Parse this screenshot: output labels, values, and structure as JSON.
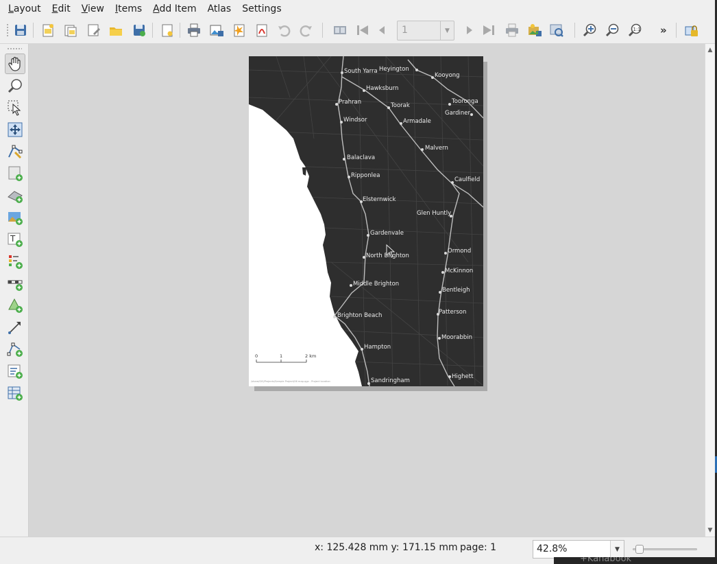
{
  "menubar": {
    "items": [
      {
        "mnemonic": "L",
        "rest": "ayout"
      },
      {
        "mnemonic": "E",
        "rest": "dit"
      },
      {
        "mnemonic": "V",
        "rest": "iew"
      },
      {
        "mnemonic": "I",
        "rest": "tems"
      },
      {
        "mnemonic": "A",
        "rest": "dd Item"
      },
      {
        "mnemonic": "",
        "rest": "Atlas"
      },
      {
        "mnemonic": "",
        "rest": "Settings"
      }
    ]
  },
  "toolbar": {
    "page_number": "1",
    "more_label": "»",
    "icons": [
      "save-icon",
      "new-layout-icon",
      "duplicate-layout-icon",
      "layout-manager-icon",
      "open-template-icon",
      "save-template-icon",
      "page-properties-icon",
      "print-icon",
      "export-image-icon",
      "export-svg-icon",
      "export-pdf-icon",
      "undo-icon",
      "redo-icon",
      "atlas-preview-icon",
      "atlas-first-icon",
      "atlas-previous-icon",
      "atlas-next-icon",
      "atlas-last-icon",
      "atlas-print-icon",
      "atlas-export-image-icon",
      "atlas-settings-icon",
      "zoom-in-icon",
      "zoom-out-icon",
      "zoom-actual-icon",
      "lock-icon"
    ]
  },
  "left_tools": [
    "pan-icon",
    "zoom-tool-icon",
    "select-move-icon",
    "move-content-icon",
    "edit-nodes-icon",
    "add-map-icon",
    "add-3d-map-icon",
    "add-picture-icon",
    "add-label-icon",
    "add-legend-icon",
    "add-scalebar-icon",
    "add-shape-icon",
    "add-arrow-icon",
    "add-nodes-icon",
    "add-html-icon",
    "add-attribute-table-icon"
  ],
  "map": {
    "stations": [
      "South Yarra",
      "Heyington",
      "Kooyong",
      "Hawksburn",
      "Prahran",
      "Toorak",
      "Tooronga",
      "Gardiner",
      "Windsor",
      "Armadale",
      "Malvern",
      "Balaclava",
      "Ripponlea",
      "Caulfield",
      "Elsternwick",
      "Glen Huntly",
      "Gardenvale",
      "Ormond",
      "North Brighton",
      "McKinnon",
      "Middle Brighton",
      "Bentleigh",
      "Brighton Beach",
      "Patterson",
      "Moorabbin",
      "Hampton",
      "Highett",
      "Sandringham"
    ],
    "scalebar": {
      "ticks": [
        "0",
        "1",
        "2 km"
      ]
    },
    "footer": "/share/GIS/Projects/Sample Project/06 map.qgz - Project location"
  },
  "status": {
    "coords": "x: 125.428 mm  y: 171.15 mm",
    "page": "page: 1",
    "zoom": "42.8%",
    "zoom_level": 0.05
  },
  "background_window_text": "+Kanabook"
}
